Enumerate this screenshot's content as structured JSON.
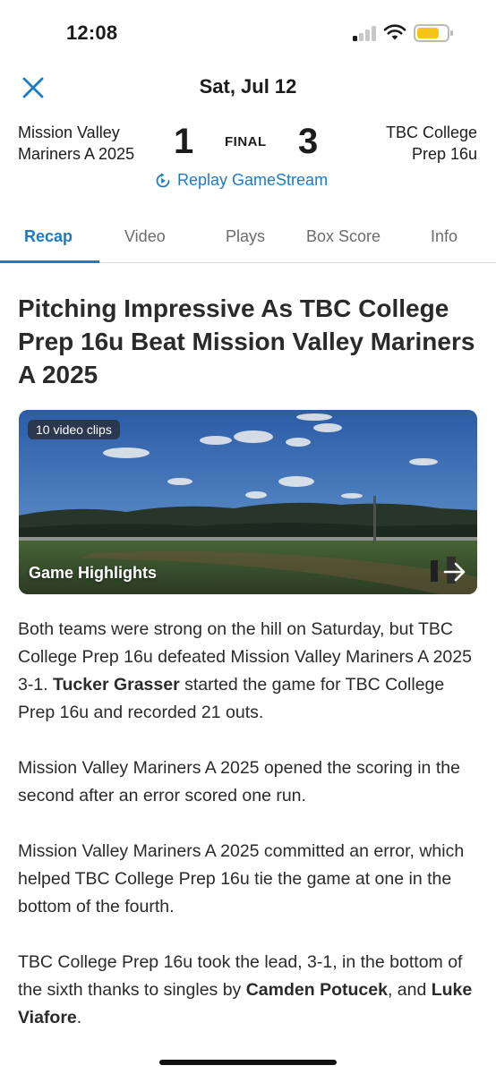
{
  "status_bar": {
    "time": "12:08",
    "battery_color": "#f5c518"
  },
  "header": {
    "close_icon": "close-icon",
    "date": "Sat, Jul 12"
  },
  "scoreboard": {
    "home_team": {
      "line1": "Mission Valley",
      "line2": "Mariners A 2025",
      "score": "1"
    },
    "away_team": {
      "line1": "TBC College",
      "line2": "Prep 16u",
      "score": "3"
    },
    "status": "FINAL",
    "replay_label": "Replay GameStream"
  },
  "tabs": [
    {
      "label": "Recap",
      "active": true
    },
    {
      "label": "Video",
      "active": false
    },
    {
      "label": "Plays",
      "active": false
    },
    {
      "label": "Box Score",
      "active": false
    },
    {
      "label": "Info",
      "active": false
    }
  ],
  "article": {
    "headline": "Pitching Impressive As TBC College Prep 16u Beat Mission Valley Mariners A 2025",
    "video": {
      "badge": "10 video clips",
      "title": "Game Highlights",
      "arrow_icon": "arrow-right-icon"
    },
    "paragraphs": [
      [
        {
          "text": "Both teams were strong on the hill on Saturday, but TBC College Prep 16u defeated Mission Valley Mariners A 2025 3-1. "
        },
        {
          "text": "Tucker Grasser",
          "bold": true
        },
        {
          "text": " started the game for TBC College Prep 16u and recorded 21 outs."
        }
      ],
      [
        {
          "text": "Mission Valley Mariners A 2025 opened the scoring in the second after an error scored one run."
        }
      ],
      [
        {
          "text": "Mission Valley Mariners A 2025 committed an error, which helped TBC College Prep 16u tie the game at one in the bottom of the fourth."
        }
      ],
      [
        {
          "text": "TBC College Prep 16u took the lead, 3-1, in the bottom of the sixth thanks to singles by "
        },
        {
          "text": "Camden Potucek",
          "bold": true
        },
        {
          "text": ", and "
        },
        {
          "text": "Luke Viafore",
          "bold": true
        },
        {
          "text": "."
        }
      ]
    ]
  },
  "colors": {
    "accent": "#1f7ac4",
    "text": "#2a2a2c"
  }
}
